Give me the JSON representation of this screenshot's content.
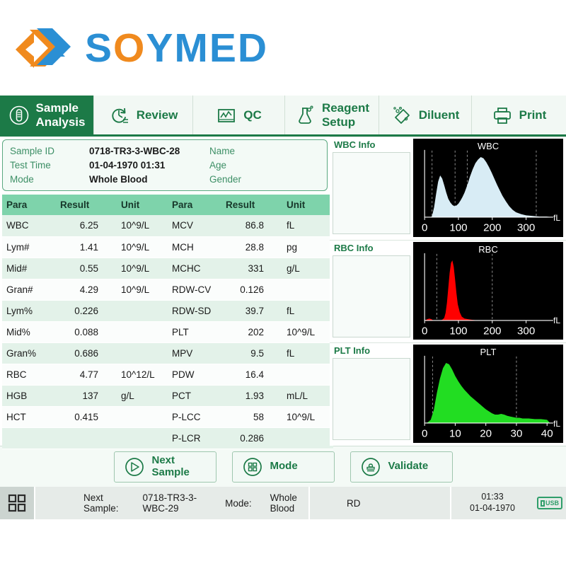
{
  "brand": {
    "name_part1": "S",
    "name_o": "O",
    "name_part2": "YMED",
    "full": "SOYMED"
  },
  "tabs": [
    {
      "id": "sample-analysis",
      "line1": "Sample",
      "line2": "Analysis",
      "icon": "test-tube-icon",
      "active": true
    },
    {
      "id": "review",
      "line1": "Review",
      "line2": "",
      "icon": "history-clock-icon",
      "active": false
    },
    {
      "id": "qc",
      "line1": "QC",
      "line2": "",
      "icon": "chart-monitor-icon",
      "active": false
    },
    {
      "id": "reagent-setup",
      "line1": "Reagent",
      "line2": "Setup",
      "icon": "flask-icon",
      "active": false
    },
    {
      "id": "diluent",
      "line1": "Diluent",
      "line2": "",
      "icon": "diluent-tag-icon",
      "active": false
    },
    {
      "id": "print",
      "line1": "Print",
      "line2": "",
      "icon": "printer-icon",
      "active": false
    }
  ],
  "sample_info": {
    "sample_id_label": "Sample ID",
    "sample_id_value": "0718-TR3-3-WBC-28",
    "name_label": "Name",
    "test_time_label": "Test Time",
    "test_time_value": "01-04-1970 01:31",
    "age_label": "Age",
    "mode_label": "Mode",
    "mode_value": "Whole Blood",
    "gender_label": "Gender"
  },
  "results_table": {
    "headers": [
      "Para",
      "Result",
      "Unit",
      "Para",
      "Result",
      "Unit"
    ],
    "rows": [
      [
        "WBC",
        "6.25",
        "10^9/L",
        "MCV",
        "86.8",
        "fL"
      ],
      [
        "Lym#",
        "1.41",
        "10^9/L",
        "MCH",
        "28.8",
        "pg"
      ],
      [
        "Mid#",
        "0.55",
        "10^9/L",
        "MCHC",
        "331",
        "g/L"
      ],
      [
        "Gran#",
        "4.29",
        "10^9/L",
        "RDW-CV",
        "0.126",
        ""
      ],
      [
        "Lym%",
        "0.226",
        "",
        "RDW-SD",
        "39.7",
        "fL"
      ],
      [
        "Mid%",
        "0.088",
        "",
        "PLT",
        "202",
        "10^9/L"
      ],
      [
        "Gran%",
        "0.686",
        "",
        "MPV",
        "9.5",
        "fL"
      ],
      [
        "RBC",
        "4.77",
        "10^12/L",
        "PDW",
        "16.4",
        ""
      ],
      [
        "HGB",
        "137",
        "g/L",
        "PCT",
        "1.93",
        "mL/L"
      ],
      [
        "HCT",
        "0.415",
        "",
        "P-LCC",
        "58",
        "10^9/L"
      ],
      [
        "",
        "",
        "",
        "P-LCR",
        "0.286",
        ""
      ]
    ]
  },
  "info_panes": [
    {
      "id": "wbc-info",
      "title": "WBC Info"
    },
    {
      "id": "rbc-info",
      "title": "RBC Info"
    },
    {
      "id": "plt-info",
      "title": "PLT Info"
    }
  ],
  "chart_data": [
    {
      "type": "area",
      "id": "wbc-histogram",
      "title": "WBC",
      "xlabel": "fL",
      "ylabel": "",
      "xlim": [
        0,
        380
      ],
      "ticks": [
        0,
        100,
        200,
        300
      ],
      "color": "#d8ecf5",
      "markers": [
        22,
        90,
        126,
        330
      ],
      "x": [
        0,
        10,
        18,
        22,
        28,
        34,
        40,
        46,
        52,
        58,
        64,
        70,
        76,
        82,
        88,
        94,
        100,
        106,
        112,
        118,
        126,
        134,
        142,
        150,
        158,
        166,
        174,
        182,
        190,
        198,
        206,
        214,
        222,
        230,
        240,
        250,
        260,
        270,
        285,
        300,
        320,
        340,
        360,
        380
      ],
      "y": [
        0,
        0,
        0,
        2,
        16,
        38,
        58,
        68,
        63,
        52,
        40,
        30,
        24,
        20,
        18,
        19,
        22,
        27,
        33,
        40,
        52,
        66,
        78,
        88,
        94,
        98,
        96,
        90,
        82,
        73,
        63,
        53,
        44,
        35,
        26,
        18,
        12,
        8,
        5,
        3,
        2,
        1,
        1,
        0
      ]
    },
    {
      "type": "area",
      "id": "rbc-histogram",
      "title": "RBC",
      "xlabel": "fL",
      "ylabel": "",
      "xlim": [
        0,
        380
      ],
      "ticks": [
        0,
        100,
        200,
        300
      ],
      "color": "#ff0000",
      "markers": [
        36,
        200
      ],
      "x": [
        0,
        8,
        14,
        20,
        26,
        34,
        44,
        52,
        58,
        62,
        66,
        70,
        74,
        78,
        82,
        86,
        90,
        94,
        98,
        104,
        110,
        118,
        128,
        140,
        160,
        200,
        250,
        300,
        340,
        380
      ],
      "y": [
        0,
        2,
        3,
        2,
        0,
        0,
        0,
        1,
        4,
        12,
        28,
        52,
        76,
        92,
        96,
        86,
        66,
        44,
        26,
        13,
        6,
        3,
        2,
        1,
        0,
        0,
        0,
        0,
        0,
        0
      ]
    },
    {
      "type": "area",
      "id": "plt-histogram",
      "title": "PLT",
      "xlabel": "fL",
      "ylabel": "",
      "xlim": [
        0,
        42
      ],
      "ticks": [
        0,
        10,
        20,
        30,
        40
      ],
      "color": "#22dd22",
      "markers": [
        2.6,
        30
      ],
      "x": [
        0,
        1,
        2,
        3,
        4,
        5,
        6,
        7,
        8,
        9,
        10,
        11,
        12,
        13,
        14,
        15,
        16,
        17,
        18,
        19,
        20,
        21,
        22,
        23,
        24,
        25,
        26,
        27,
        28,
        29,
        30,
        31,
        32,
        34,
        36,
        38,
        40,
        41
      ],
      "y": [
        0,
        1,
        5,
        20,
        46,
        68,
        84,
        92,
        90,
        82,
        72,
        64,
        57,
        51,
        46,
        41,
        37,
        33,
        29,
        25,
        21,
        18,
        15,
        13,
        13,
        14,
        13,
        11,
        10,
        9,
        8,
        8,
        7,
        7,
        6,
        6,
        5,
        0
      ]
    }
  ],
  "action_buttons": [
    {
      "id": "next-sample",
      "line1": "Next",
      "line2": "Sample",
      "icon": "play-circle-icon"
    },
    {
      "id": "mode",
      "line1": "Mode",
      "line2": "",
      "icon": "grid-circle-icon"
    },
    {
      "id": "validate",
      "line1": "Validate",
      "line2": "",
      "icon": "stamp-circle-icon"
    }
  ],
  "status_bar": {
    "next_sample_label": "Next Sample:",
    "next_sample_value": "0718-TR3-3-WBC-29",
    "mode_label": "Mode:",
    "mode_value": "Whole Blood",
    "state": "RD",
    "time": "01:33",
    "date": "01-04-1970",
    "usb_label": "USB",
    "grid_icon": "grid-menu-icon"
  },
  "colors": {
    "brand_blue": "#2b8fd4",
    "brand_orange": "#f08a1e",
    "accent_green": "#1c7a47",
    "table_header": "#7ed3ab",
    "wbc": "#d8ecf5",
    "rbc": "#ff0000",
    "plt": "#22dd22"
  }
}
